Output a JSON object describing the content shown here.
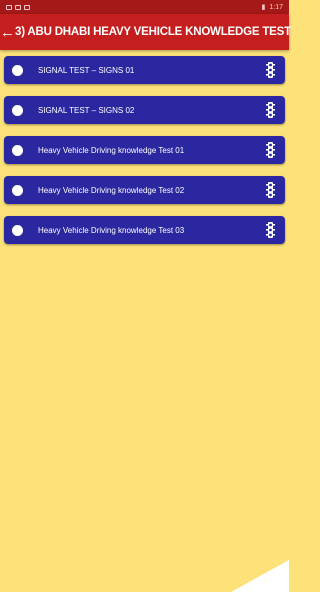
{
  "statusbar": {
    "time": "1:17"
  },
  "toolbar": {
    "back_icon": "arrow-left-icon",
    "title": "3) ABU DHABI HEAVY VEHICLE KNOWLEDGE TEST"
  },
  "colors": {
    "toolbar": "#c41e1e",
    "item": "#2b27a0",
    "background": "#fde27a"
  },
  "items": [
    {
      "label": "SIGNAL TEST – SIGNS 01",
      "icon": "traffic-light-icon"
    },
    {
      "label": "SIGNAL TEST – SIGNS 02",
      "icon": "traffic-light-icon"
    },
    {
      "label": "Heavy Vehicle Driving  knowledge Test 01",
      "icon": "traffic-light-icon"
    },
    {
      "label": "Heavy Vehicle Driving  knowledge Test 02",
      "icon": "traffic-light-icon"
    },
    {
      "label": "Heavy Vehicle Driving  knowledge Test 03",
      "icon": "traffic-light-icon"
    }
  ]
}
